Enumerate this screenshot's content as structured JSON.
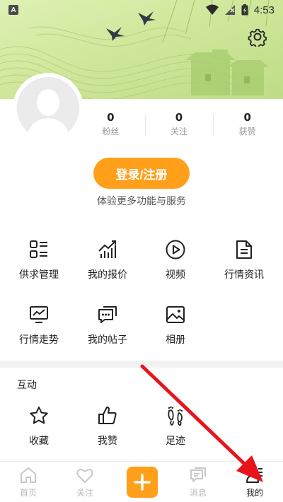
{
  "status_bar": {
    "time": "4:53",
    "left_badge": "A"
  },
  "profile": {
    "stats": [
      {
        "count": "0",
        "label": "粉丝"
      },
      {
        "count": "0",
        "label": "关注"
      },
      {
        "count": "0",
        "label": "获赞"
      }
    ],
    "login_button": "登录/注册",
    "login_subtitle": "体验更多功能与服务"
  },
  "services": [
    {
      "label": "供求管理",
      "icon": "list-grid-icon"
    },
    {
      "label": "我的报价",
      "icon": "trend-chart-icon"
    },
    {
      "label": "视频",
      "icon": "play-circle-icon"
    },
    {
      "label": "行情资讯",
      "icon": "document-icon"
    },
    {
      "label": "行情走势",
      "icon": "monitor-chart-icon"
    },
    {
      "label": "我的帖子",
      "icon": "chat-bubble-icon"
    },
    {
      "label": "相册",
      "icon": "image-icon"
    }
  ],
  "interaction": {
    "title": "互动",
    "items": [
      {
        "label": "收藏",
        "icon": "star-icon"
      },
      {
        "label": "我赞",
        "icon": "thumb-up-icon"
      },
      {
        "label": "足迹",
        "icon": "footprint-icon"
      }
    ]
  },
  "bottom_nav": [
    {
      "label": "首页",
      "icon": "home-icon"
    },
    {
      "label": "关注",
      "icon": "heart-icon"
    },
    {
      "label": "",
      "icon": "plus-icon"
    },
    {
      "label": "消息",
      "icon": "message-icon"
    },
    {
      "label": "我的",
      "icon": "profile-icon",
      "active": true
    }
  ],
  "colors": {
    "accent": "#ff9f1a",
    "banner": "#cfe79a",
    "annotation_arrow": "#e8141b"
  }
}
